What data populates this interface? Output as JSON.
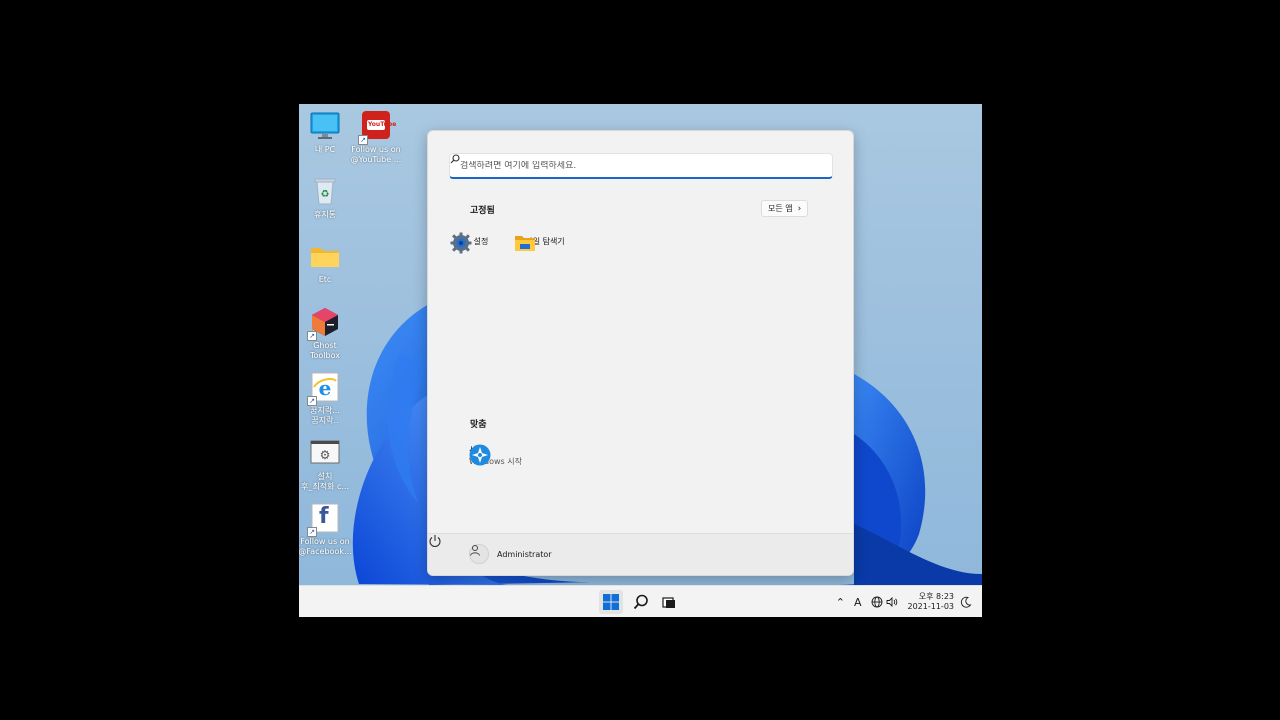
{
  "desktop": {
    "icons": [
      {
        "label_lines": [
          "내 PC"
        ],
        "icon": "monitor-icon"
      },
      {
        "label_lines": [
          "Follow us on",
          "@YouTube ..."
        ],
        "icon": "youtube-icon",
        "badge_text": "YouTube"
      },
      {
        "label_lines": [
          "휴지통"
        ],
        "icon": "recycle-bin-icon"
      },
      {
        "label_lines": [
          "Etc"
        ],
        "icon": "folder-icon"
      },
      {
        "label_lines": [
          "Ghost",
          "Toolbox"
        ],
        "icon": "ghost-toolbox-icon"
      },
      {
        "label_lines": [
          "꿈지락...",
          "꿈지락.."
        ],
        "icon": "internet-explorer-icon"
      },
      {
        "label_lines": [
          "설치",
          "후_최적화 c..."
        ],
        "icon": "settings-script-icon"
      },
      {
        "label_lines": [
          "Follow us on",
          "@Facebook..."
        ],
        "icon": "facebook-icon",
        "badge_text": "f"
      }
    ]
  },
  "start_menu": {
    "search_placeholder": "검색하려면 여기에 입력하세요.",
    "pinned_title": "고정됨",
    "all_apps_label": "모든 앱",
    "pinned_apps": [
      {
        "label": "설정",
        "icon": "settings-gear-icon"
      },
      {
        "label": "파일 탐색기",
        "icon": "file-explorer-icon"
      }
    ],
    "recommended_title": "맞춤",
    "recommended": [
      {
        "title": "시작",
        "subtitle": "Windows 시작",
        "icon": "get-started-icon"
      }
    ],
    "user_name": "Administrator"
  },
  "taskbar": {
    "tray_input_indicator": "A",
    "clock_time": "오후 8:23",
    "clock_date": "2021-11-03"
  },
  "colors": {
    "accent": "#1a66c4",
    "taskbar_bg": "#f3f3f3",
    "start_bg": "#f2f2f2"
  }
}
